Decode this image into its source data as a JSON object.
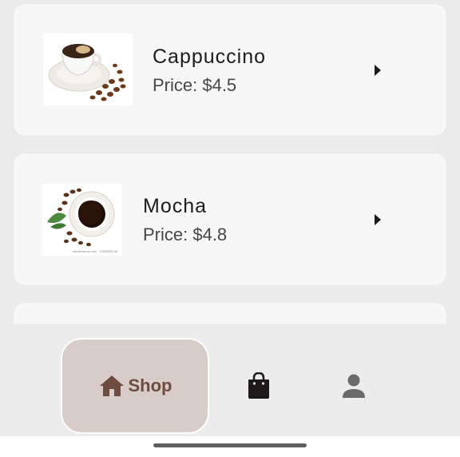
{
  "products": [
    {
      "name": "Cappuccino",
      "price": "Price: $4.5",
      "image_icon": "cappuccino-cup-icon"
    },
    {
      "name": "Mocha",
      "price": "Price: $4.8",
      "image_icon": "mocha-cup-icon"
    }
  ],
  "nav": {
    "items": [
      {
        "label": "Shop",
        "icon": "home-icon",
        "selected": true
      },
      {
        "label": "",
        "icon": "shopping-bag-icon",
        "selected": false
      },
      {
        "label": "",
        "icon": "person-icon",
        "selected": false
      }
    ]
  },
  "colors": {
    "background": "#ececec",
    "card": "#f7f7f7",
    "nav_selected_bg": "#d7ccc8",
    "accent_brown": "#6d4c41",
    "text_primary": "#1d1b1b"
  }
}
